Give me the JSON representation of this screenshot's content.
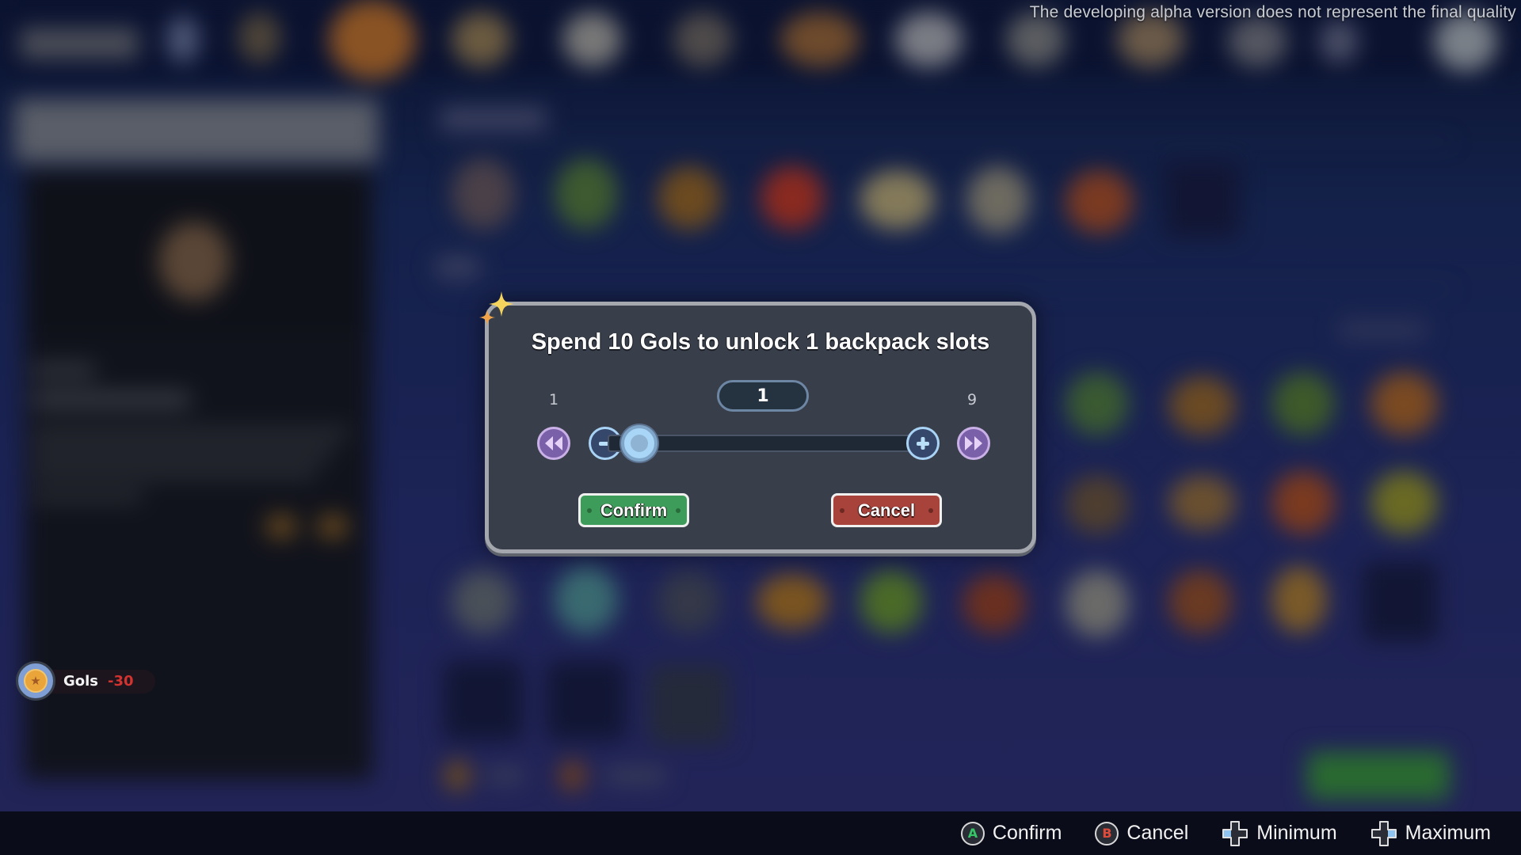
{
  "notice": "The developing alpha version does not represent the final quality",
  "currency": {
    "icon": "star-coin-icon",
    "name": "Gols",
    "change": "-30",
    "change_color": "#d2332f"
  },
  "dialog": {
    "title": "Spend 10 Gols to unlock 1 backpack slots",
    "min_label": "1",
    "max_label": "9",
    "value": "1",
    "slider": {
      "min": 1,
      "max": 9,
      "value": 1
    },
    "buttons": {
      "rewind_icon": "rewind-to-min-icon",
      "minus_icon": "minus-icon",
      "plus_icon": "plus-icon",
      "fast_forward_icon": "fast-forward-to-max-icon",
      "confirm": "Confirm",
      "cancel": "Cancel"
    },
    "colors": {
      "confirm": "#3e9c5a",
      "cancel": "#a8433b",
      "panel": "#383e4a"
    }
  },
  "hints": [
    {
      "button": "A",
      "icon": "a-button-icon",
      "label": "Confirm"
    },
    {
      "button": "B",
      "icon": "b-button-icon",
      "label": "Cancel"
    },
    {
      "button": "D-Pad Left",
      "icon": "dpad-left-icon",
      "label": "Minimum"
    },
    {
      "button": "D-Pad Right",
      "icon": "dpad-right-icon",
      "label": "Maximum"
    }
  ]
}
